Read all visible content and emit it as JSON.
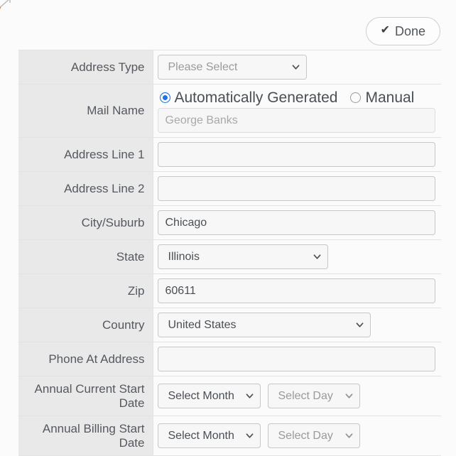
{
  "toolbar": {
    "done_label": "Done",
    "check_icon": "check-icon"
  },
  "form": {
    "rows": [
      {
        "label": "Address Type",
        "control": "select",
        "value": "Please Select"
      },
      {
        "label": "Mail Name",
        "control": "radio-and-input",
        "radios": [
          {
            "label": "Automatically Generated",
            "checked": true
          },
          {
            "label": "Manual",
            "checked": false
          }
        ],
        "value": "",
        "placeholder": "George Banks",
        "disabled": true
      },
      {
        "label": "Address Line 1",
        "control": "text",
        "value": "",
        "placeholder": ""
      },
      {
        "label": "Address Line 2",
        "control": "text",
        "value": "",
        "placeholder": ""
      },
      {
        "label": "City/Suburb",
        "control": "text",
        "value": "Chicago",
        "placeholder": ""
      },
      {
        "label": "State",
        "control": "select",
        "value": "Illinois"
      },
      {
        "label": "Zip",
        "control": "text",
        "value": "60611",
        "placeholder": ""
      },
      {
        "label": "Country",
        "control": "select",
        "value": "United States"
      },
      {
        "label": "Phone At Address",
        "control": "text",
        "value": "",
        "placeholder": ""
      },
      {
        "label": "Annual Current Start Date",
        "control": "date",
        "month_value": "Select Month",
        "day_value": "Select Day"
      },
      {
        "label": "Annual Billing Start Date",
        "control": "date",
        "month_value": "Select Month",
        "day_value": "Select Day"
      }
    ]
  },
  "colors": {
    "page_background": "#fbfbfb",
    "label_column": "#e9e9e9",
    "row_border": "#e3e3e3",
    "input_border": "#c7c7c7",
    "input_background": "#f7f7f7",
    "text": "#4a4f55",
    "muted_text": "#9a9a9a",
    "radio_accent": "#1a73e8"
  }
}
